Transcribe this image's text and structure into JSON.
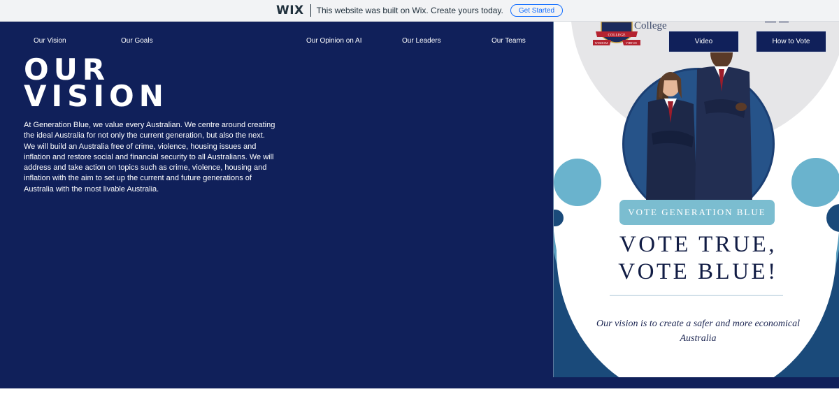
{
  "wix_banner": {
    "logo": "WIX",
    "message": "This website was built on Wix. Create yours today.",
    "cta": "Get Started"
  },
  "nav": {
    "items": [
      {
        "label": "Our Vision"
      },
      {
        "label": "Our Goals"
      },
      {
        "label": "Our Opinion on AI"
      },
      {
        "label": "Our Leaders"
      },
      {
        "label": "Our Teams"
      },
      {
        "label": "Video"
      },
      {
        "label": "How to Vote"
      }
    ]
  },
  "hero": {
    "title_line1": "OUR",
    "title_line2": "VISION",
    "body": "At Generation Blue, we value every Australian. We centre around creating the ideal Australia for not only the current generation, but also the next. We will build an Australia free of crime, violence, housing issues and inflation and restore social and financial security to all Australians. We will address and take action on topics such as crime, violence, housing and inflation with the aim to set up the current and future generations of Australia with the most livable Australia."
  },
  "poster": {
    "college": "College",
    "crest_ribbon": "COLLEGE",
    "crest_motto_left": "WISDOM",
    "crest_motto_right": "VIRTUE",
    "pill": "VOTE GENERATION BLUE",
    "headline_line1": "VOTE TRUE,",
    "headline_line2": "VOTE BLUE!",
    "tagline": "Our vision is to create a safer and more economical Australia"
  },
  "colors": {
    "navy": "#10205a",
    "light_blue": "#7bbdd0",
    "wix_blue": "#116dff"
  }
}
